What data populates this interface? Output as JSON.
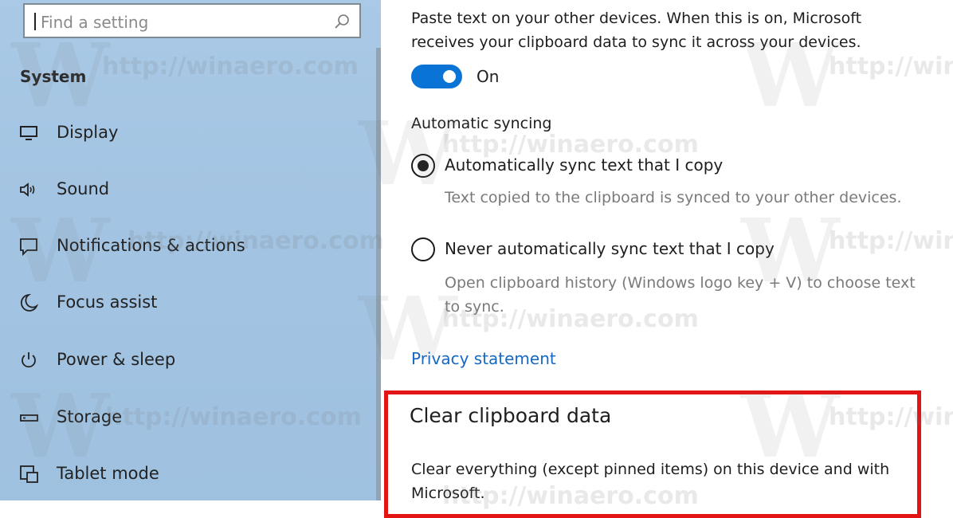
{
  "search": {
    "placeholder": "Find a setting"
  },
  "sidebar": {
    "section_title": "System",
    "items": [
      {
        "label": "Display",
        "icon": "monitor-icon"
      },
      {
        "label": "Sound",
        "icon": "speaker-icon"
      },
      {
        "label": "Notifications & actions",
        "icon": "notification-icon"
      },
      {
        "label": "Focus assist",
        "icon": "moon-icon"
      },
      {
        "label": "Power & sleep",
        "icon": "power-icon"
      },
      {
        "label": "Storage",
        "icon": "storage-icon"
      },
      {
        "label": "Tablet mode",
        "icon": "tablet-mode-icon"
      }
    ]
  },
  "main": {
    "sync_description": "Paste text on your other devices. When this is on, Microsoft receives your clipboard data to sync it across your devices.",
    "toggle": {
      "state": "On",
      "on": true
    },
    "auto_sync": {
      "title": "Automatic syncing",
      "options": [
        {
          "label": "Automatically sync text that I copy",
          "hint": "Text copied to the clipboard is synced to your other devices.",
          "selected": true
        },
        {
          "label": "Never automatically sync text that I copy",
          "hint": "Open clipboard history (Windows logo key + V) to choose text to sync.",
          "selected": false
        }
      ]
    },
    "privacy_link": "Privacy statement",
    "clear": {
      "title": "Clear clipboard data",
      "description": "Clear everything (except pinned items) on this device and with Microsoft."
    }
  },
  "watermark": {
    "text": "http://winaero.com",
    "letter": "W"
  },
  "colors": {
    "accent": "#0a73d6",
    "link": "#1568c4",
    "highlight": "#e31414",
    "sidebar_bg": "#a3c4e2"
  }
}
